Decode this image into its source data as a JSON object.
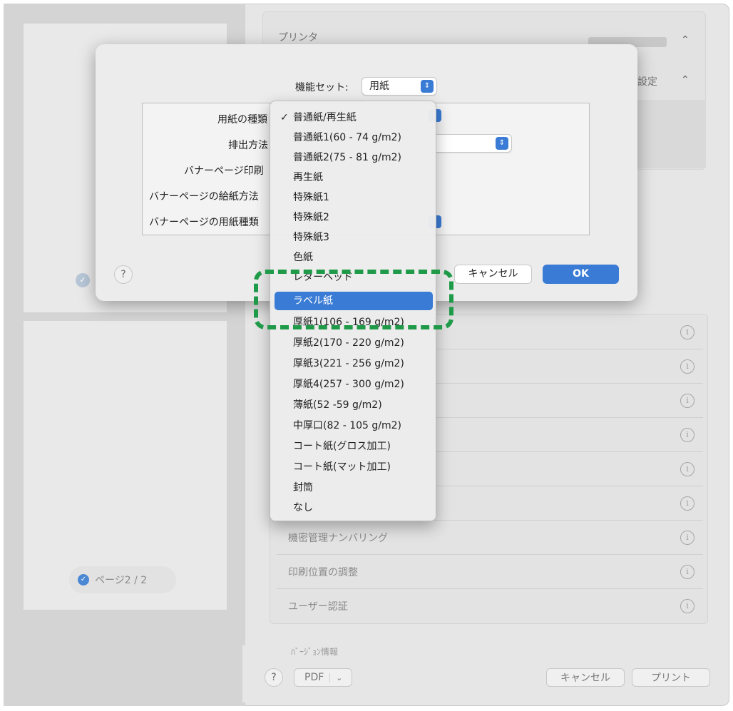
{
  "print_window": {
    "printer_label": "プリンタ",
    "preset_value": "ト設定",
    "stepper_glyph": "⌃",
    "page_badge": "ページ2 / 2",
    "cut_label": "ﾊﾞｰｼﾞｮﾝ情報",
    "options": [
      {
        "label": ""
      },
      {
        "label": ""
      },
      {
        "label": ""
      },
      {
        "label": ""
      },
      {
        "label": ""
      },
      {
        "label": ""
      },
      {
        "label": "機密管理ナンバリング"
      },
      {
        "label": "印刷位置の調整"
      },
      {
        "label": "ユーザー認証"
      }
    ],
    "help_label": "?",
    "pdf_label": "PDF",
    "pdf_arrow": "⌄",
    "cancel_label": "キャンセル",
    "print_label": "プリント"
  },
  "sheet": {
    "feature_set_label": "機能セット:",
    "feature_set_value": "用紙",
    "fields": {
      "paper_type": "用紙の種類",
      "output_method": "排出方法",
      "banner_print": "バナーページ印刷",
      "banner_tray": "バナーページの給紙方法",
      "banner_paper": "バナーページの用紙種類"
    },
    "help_label": "?",
    "cancel_label": "キャンセル",
    "ok_label": "OK"
  },
  "menu": {
    "check_glyph": "✓",
    "items": [
      {
        "label": "普通紙/再生紙",
        "checked": true
      },
      {
        "label": "普通紙1(60 - 74 g/m2)"
      },
      {
        "label": "普通紙2(75 - 81 g/m2)"
      },
      {
        "label": "再生紙"
      },
      {
        "label": "特殊紙1"
      },
      {
        "label": "特殊紙2"
      },
      {
        "label": "特殊紙3"
      },
      {
        "label": "色紙"
      },
      {
        "label": "レターヘッド"
      },
      {
        "label": "ラベル紙",
        "selected": true
      },
      {
        "label": "厚紙1(106 - 169 g/m2)"
      },
      {
        "label": "厚紙2(170 - 220 g/m2)"
      },
      {
        "label": "厚紙3(221 - 256 g/m2)"
      },
      {
        "label": "厚紙4(257 - 300 g/m2)"
      },
      {
        "label": "薄紙(52 -59 g/m2)"
      },
      {
        "label": "中厚口(82 - 105 g/m2)"
      },
      {
        "label": "コート紙(グロス加工)"
      },
      {
        "label": "コート紙(マット加工)"
      },
      {
        "label": "封筒"
      },
      {
        "label": "なし"
      }
    ]
  },
  "colors": {
    "accent": "#3a7bd5",
    "highlight": "#1f9a48"
  }
}
